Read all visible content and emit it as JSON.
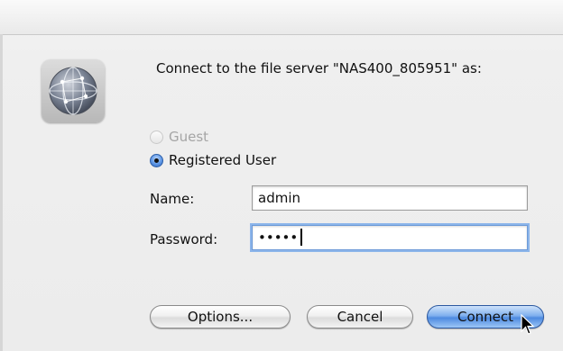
{
  "dialog": {
    "prompt": "Connect to the file server \"NAS400_805951\" as:",
    "login_type": {
      "guest_label": "Guest",
      "guest_enabled": false,
      "registered_label": "Registered User",
      "selected": "registered"
    },
    "name_label": "Name:",
    "name_value": "admin",
    "password_label": "Password:",
    "password_mask": "•••••",
    "buttons": {
      "options": "Options...",
      "cancel": "Cancel",
      "connect": "Connect"
    },
    "icon": "network-globe-icon"
  },
  "colors": {
    "default_button": "#6fa2ea",
    "focus_ring": "#8cb5ea",
    "disabled_text": "#a5a5a5"
  }
}
